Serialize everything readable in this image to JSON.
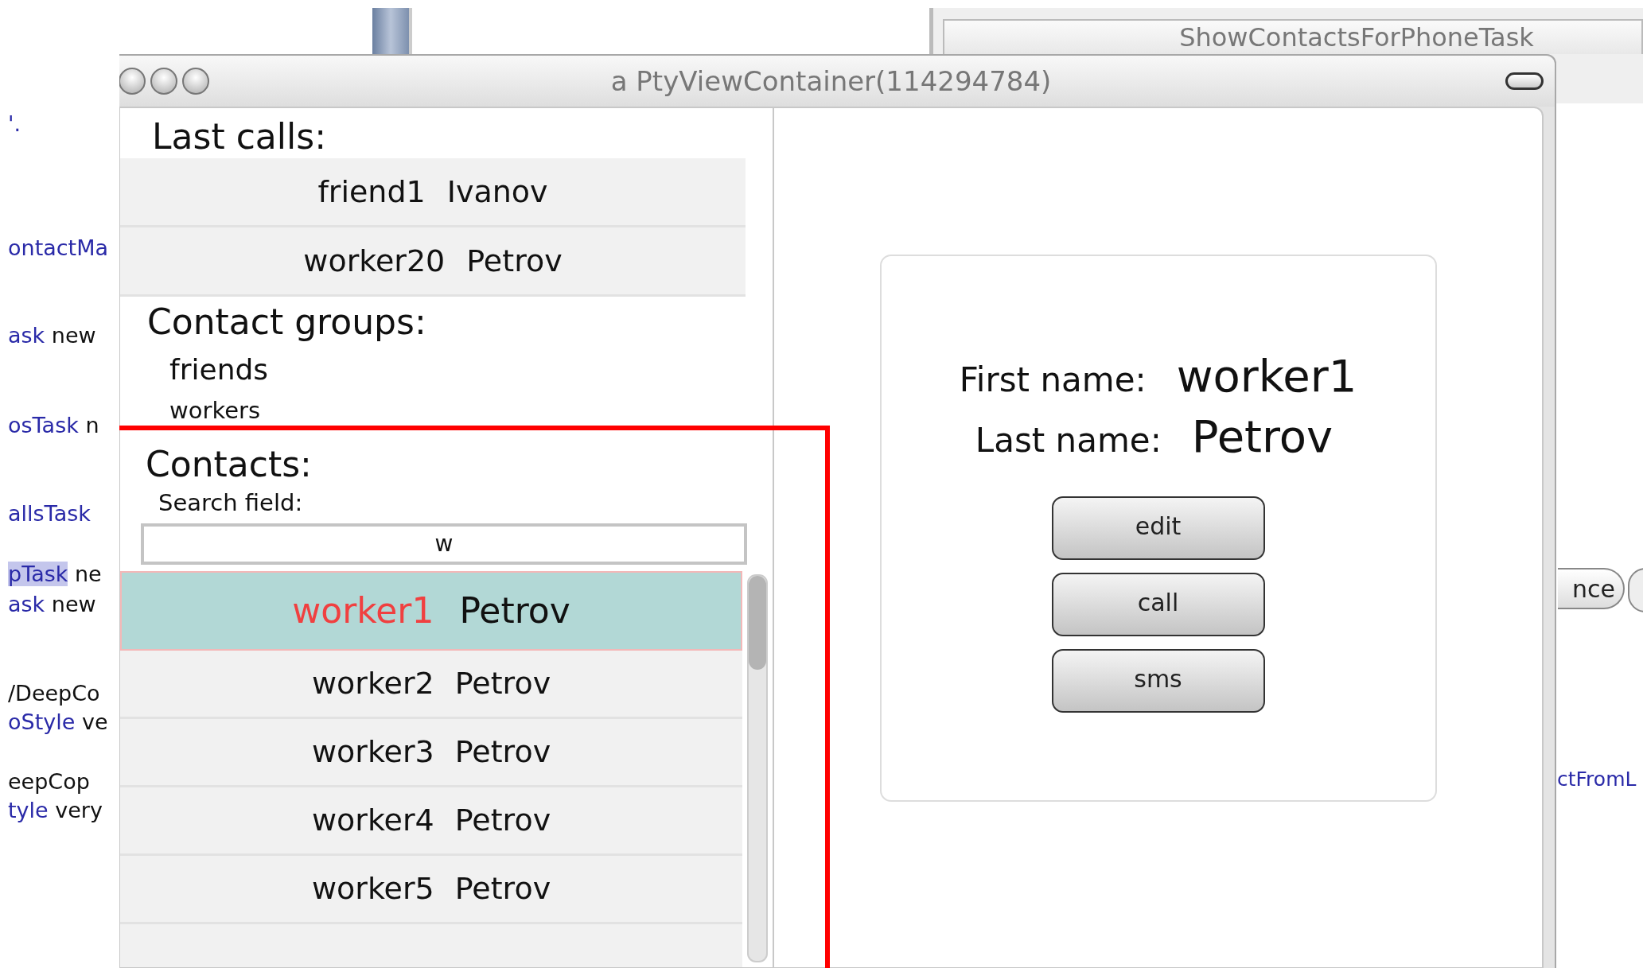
{
  "background": {
    "code_lines": [
      {
        "segments": [
          {
            "text": "'.",
            "kind": "ident"
          }
        ]
      },
      {
        "segments": [
          {
            "text": "ontactMa",
            "kind": "ident"
          }
        ]
      },
      {
        "segments": [
          {
            "text": "ask",
            "kind": "ident"
          },
          {
            "text": " new",
            "kind": "plain"
          }
        ]
      },
      {
        "segments": [
          {
            "text": "osTask",
            "kind": "ident"
          },
          {
            "text": " n",
            "kind": "plain"
          }
        ]
      },
      {
        "segments": [
          {
            "text": "allsTask",
            "kind": "ident"
          }
        ]
      },
      {
        "segments": [
          {
            "text": "pTask",
            "kind": "selected"
          },
          {
            "text": " ne",
            "kind": "plain"
          }
        ]
      },
      {
        "segments": [
          {
            "text": "ask",
            "kind": "ident"
          },
          {
            "text": " new",
            "kind": "plain"
          }
        ]
      },
      {
        "segments": [
          {
            "text": "/DeepCo",
            "kind": "plain"
          }
        ]
      },
      {
        "segments": [
          {
            "text": "oStyle",
            "kind": "ident"
          },
          {
            "text": " ve",
            "kind": "plain"
          }
        ]
      },
      {
        "segments": [
          {
            "text": "eepCop",
            "kind": "plain"
          }
        ]
      },
      {
        "segments": [
          {
            "text": "tyle",
            "kind": "ident"
          },
          {
            "text": " very",
            "kind": "plain"
          }
        ]
      }
    ],
    "window_title": "ShowContactsForPhoneTask",
    "button_label": "nce",
    "link": "ctFromL"
  },
  "window": {
    "title": "a PtyViewContainer(114294784)"
  },
  "last_calls": {
    "heading": "Last calls:",
    "items": [
      {
        "first": "friend1",
        "last": "Ivanov"
      },
      {
        "first": "worker20",
        "last": "Petrov"
      }
    ]
  },
  "groups": {
    "heading": "Contact groups:",
    "items": [
      "friends",
      "workers"
    ]
  },
  "contacts": {
    "heading": "Contacts:",
    "search_label": "Search field:",
    "search_value": "w",
    "items": [
      {
        "first": "worker1",
        "last": "Petrov",
        "selected": true
      },
      {
        "first": "worker2",
        "last": "Petrov",
        "selected": false
      },
      {
        "first": "worker3",
        "last": "Petrov",
        "selected": false
      },
      {
        "first": "worker4",
        "last": "Petrov",
        "selected": false
      },
      {
        "first": "worker5",
        "last": "Petrov",
        "selected": false
      }
    ]
  },
  "details": {
    "first_label": "First name:",
    "first_value": "worker1",
    "last_label": "Last name:",
    "last_value": "Petrov",
    "buttons": [
      "edit",
      "call",
      "sms"
    ]
  }
}
